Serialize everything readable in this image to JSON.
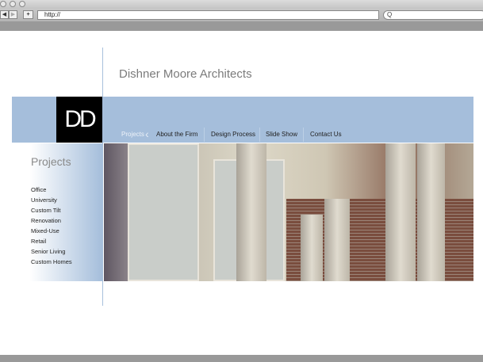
{
  "browser": {
    "url": "http://",
    "search_icon": "Q",
    "back": "◀",
    "forward": "▶",
    "add": "+"
  },
  "site": {
    "title": "Dishner Moore Architects",
    "logo": "DD"
  },
  "nav": [
    {
      "label": "Projects",
      "active": true
    },
    {
      "label": "About the Firm"
    },
    {
      "label": "Design Process"
    },
    {
      "label": "Slide Show"
    },
    {
      "label": "Contact Us"
    }
  ],
  "sidebar": {
    "title": "Projects",
    "items": [
      "Office",
      "University",
      "Custom Tilt",
      "Renovation",
      "Mixed-Use",
      "Retail",
      "Senior Living",
      "Custom Homes"
    ]
  },
  "colors": {
    "accent": "#a5bedb"
  }
}
